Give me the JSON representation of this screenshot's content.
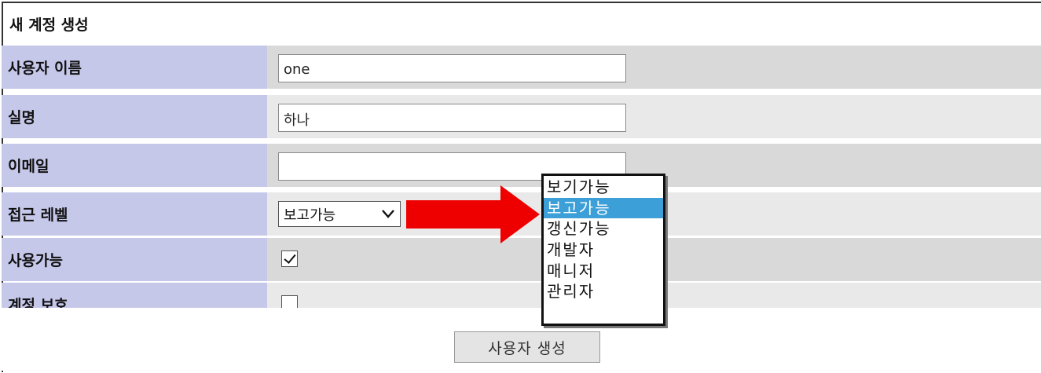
{
  "form": {
    "title": "새 계정 생성",
    "username_label": "사용자 이름",
    "username_value": "one",
    "fullname_label": "실명",
    "fullname_value": "하나",
    "email_label": "이메일",
    "email_value": "",
    "access_label": "접근 레벨",
    "access_selected": "보고가능",
    "enabled_label": "사용가능",
    "enabled_checked": true,
    "protected_label": "계정 보호",
    "protected_checked": false,
    "submit_label": "사용자 생성"
  },
  "dropdown": {
    "options": [
      "보기가능",
      "보고가능",
      "갱신가능",
      "개발자",
      "매니저",
      "관리자"
    ],
    "highlighted_index": 1
  },
  "colors": {
    "label_bg": "#c6c8ea",
    "row_dark": "#d9d9d9",
    "row_light": "#e9e9e9",
    "highlight": "#3d9fd8",
    "arrow": "#ee0000"
  }
}
